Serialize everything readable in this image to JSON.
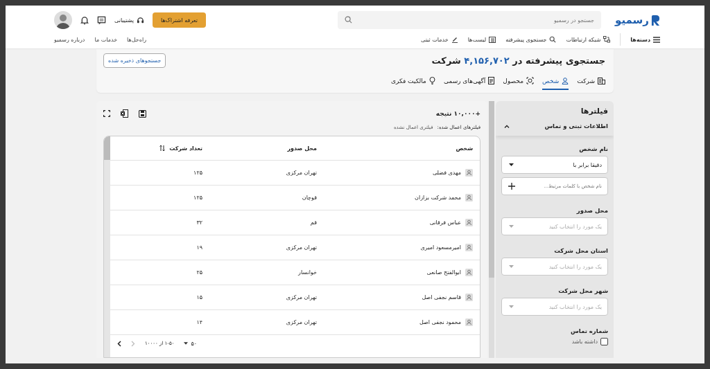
{
  "header": {
    "logo_text": "رسمیو",
    "search": {
      "placeholder": "جستجو در رسمیو"
    },
    "subscribe_button": "تعرفه اشتراک‌ها",
    "support": "پشتیبانی",
    "menu": "دسته‌ها",
    "nav": [
      {
        "label": "شبکه ارتباطات"
      },
      {
        "label": "جستجوی پیشرفته"
      },
      {
        "label": "لیست‌ها"
      },
      {
        "label": "خدمات ثبتی"
      }
    ],
    "links": [
      "راه‌حل‌ها",
      "خدمات ما",
      "درباره رسمیو"
    ]
  },
  "title": {
    "prefix": "جستجوی پیشرفته در",
    "count": "۴,۱۵۶,۷۰۲",
    "suffix": "شرکت"
  },
  "saved_searches_button": "جستجوهای ذخیره شده",
  "tabs": [
    {
      "label": "شرکت",
      "selected": false
    },
    {
      "label": "شخص",
      "selected": true
    },
    {
      "label": "محصول",
      "selected": false
    },
    {
      "label": "آگهی‌های رسمی",
      "selected": false
    },
    {
      "label": "مالکیت فکری",
      "selected": false
    }
  ],
  "results": {
    "count": "+۱۰,۰۰۰ نتیجه",
    "applied_label": "فیلترهای اعمال شده:",
    "applied_value": "فیلتری اعمال نشده"
  },
  "table": {
    "columns": [
      "شخص",
      "محل صدور",
      "تعداد شرکت"
    ],
    "rows": [
      [
        "مهدی فضلی",
        "تهران مرکزی",
        "۱۲۵"
      ],
      [
        "محمد شرکت بزازان",
        "قوچان",
        "۱۲۵"
      ],
      [
        "عباس فرقانی",
        "قم",
        "۳۲"
      ],
      [
        "امیرمسعود امیری",
        "تهران مرکزی",
        "۱۹"
      ],
      [
        "ابوالفتح صانعی",
        "خوانسار",
        "۲۵"
      ],
      [
        "قاسم نجفی اصل",
        "تهران مرکزی",
        "۱۵"
      ],
      [
        "محمود نجفی اصل",
        "تهران مرکزی",
        "۱۴"
      ]
    ],
    "page_size": "۵۰",
    "range": "۱-۵۰ از ۱۰۰۰۰"
  },
  "filters": {
    "title": "فیلترها",
    "section": {
      "title": "اطلاعات ثبتی و تماس",
      "expanded": true
    },
    "groups": [
      {
        "label": "نام شخص",
        "controls": [
          {
            "kind": "select",
            "value": "دقیقا برابر با"
          },
          {
            "kind": "input",
            "placeholder": "نام شخص با کلمات مرتبط..."
          }
        ]
      },
      {
        "label": "محل صدور",
        "controls": [
          {
            "kind": "select",
            "placeholder": "یک مورد را انتخاب کنید"
          }
        ]
      },
      {
        "label": "استان محل شرکت",
        "controls": [
          {
            "kind": "select",
            "placeholder": "یک مورد را انتخاب کنید"
          }
        ]
      },
      {
        "label": "شهر محل شرکت",
        "controls": [
          {
            "kind": "select",
            "placeholder": "یک مورد را انتخاب کنید"
          }
        ]
      },
      {
        "label": "شماره تماس",
        "controls": [
          {
            "kind": "checkbox",
            "label": "داشته باشد",
            "checked": false
          }
        ]
      }
    ]
  }
}
